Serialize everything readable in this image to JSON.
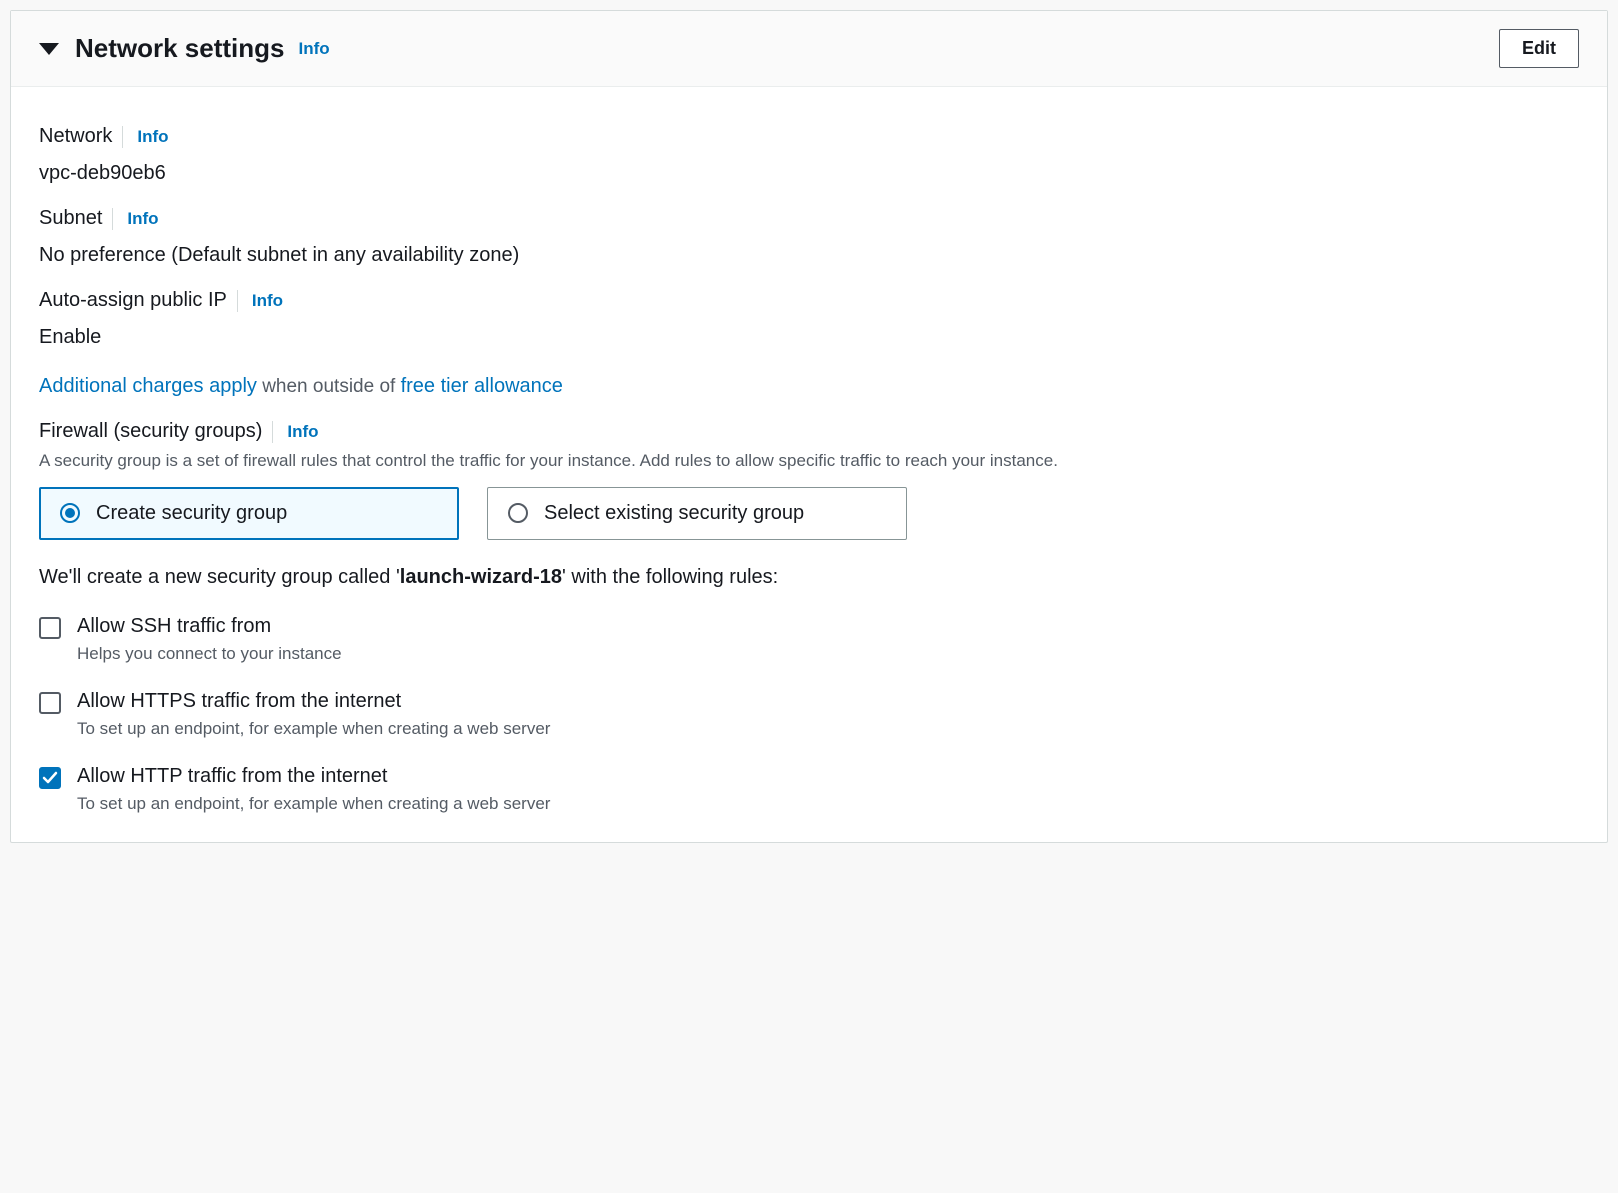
{
  "header": {
    "title": "Network settings",
    "info": "Info",
    "edit": "Edit"
  },
  "network": {
    "label": "Network",
    "info": "Info",
    "value": "vpc-deb90eb6"
  },
  "subnet": {
    "label": "Subnet",
    "info": "Info",
    "value": "No preference (Default subnet in any availability zone)"
  },
  "public_ip": {
    "label": "Auto-assign public IP",
    "info": "Info",
    "value": "Enable"
  },
  "charges": {
    "link1": "Additional charges apply",
    "mid": " when outside of ",
    "link2": "free tier allowance"
  },
  "firewall": {
    "label": "Firewall (security groups)",
    "info": "Info",
    "desc": "A security group is a set of firewall rules that control the traffic for your instance. Add rules to allow specific traffic to reach your instance."
  },
  "sg_options": {
    "create": "Create security group",
    "select": "Select existing security group"
  },
  "sg_create": {
    "pre": "We'll create a new security group called '",
    "name": "launch-wizard-18",
    "post": "' with the following rules:"
  },
  "rules": {
    "ssh": {
      "label": "Allow SSH traffic from",
      "help": "Helps you connect to your instance"
    },
    "https": {
      "label": "Allow HTTPS traffic from the internet",
      "help": "To set up an endpoint, for example when creating a web server"
    },
    "http": {
      "label": "Allow HTTP traffic from the internet",
      "help": "To set up an endpoint, for example when creating a web server"
    }
  }
}
